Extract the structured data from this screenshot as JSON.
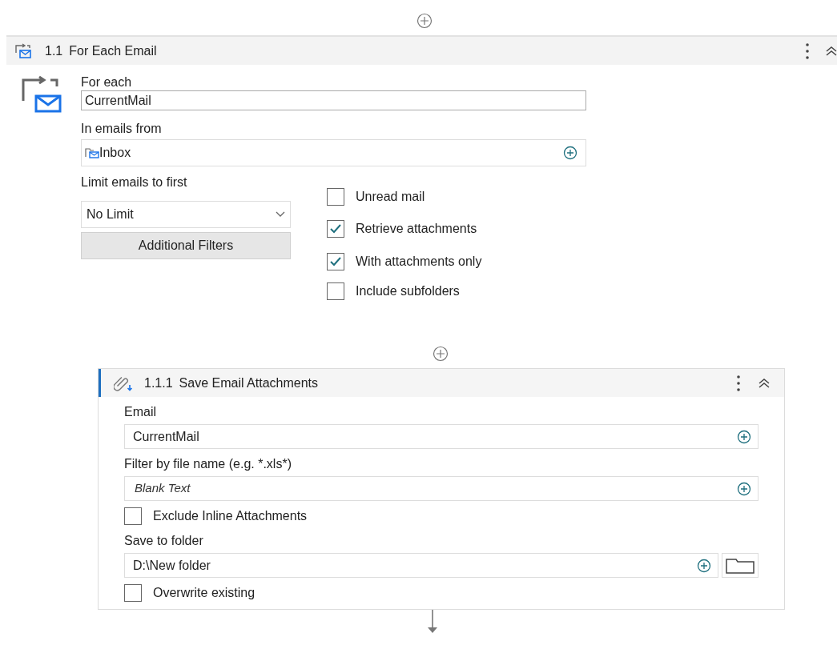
{
  "loop": {
    "number": "1.1",
    "title": "For Each Email",
    "for_each": {
      "label": "For each",
      "value": "CurrentMail"
    },
    "source": {
      "label": "In emails from",
      "value": "Inbox"
    },
    "limit": {
      "label": "Limit emails to first",
      "value": "No Limit"
    },
    "filters_button": "Additional Filters",
    "options": [
      {
        "label": "Unread mail",
        "checked": false
      },
      {
        "label": "Retrieve attachments",
        "checked": true
      },
      {
        "label": "With attachments only",
        "checked": true
      },
      {
        "label": "Include subfolders",
        "checked": false
      }
    ]
  },
  "action": {
    "number": "1.1.1",
    "title": "Save Email Attachments",
    "rows": [
      {
        "kind": "field",
        "label": "Email",
        "value": "CurrentMail"
      },
      {
        "kind": "field",
        "label": "Filter by file name (e.g. *.xls*)",
        "placeholder": "Blank Text"
      },
      {
        "kind": "checkbox",
        "label": "Exclude Inline Attachments",
        "checked": false
      },
      {
        "kind": "folder",
        "label": "Save to folder",
        "value": "D:\\New folder"
      },
      {
        "kind": "checkbox",
        "label": "Overwrite existing",
        "checked": false
      }
    ]
  }
}
